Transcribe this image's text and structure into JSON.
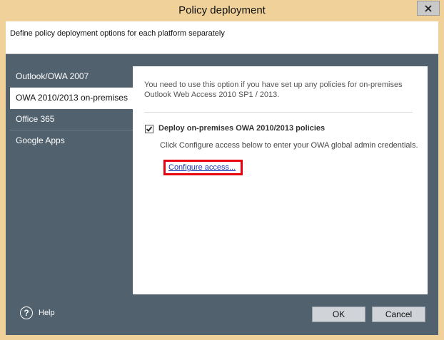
{
  "window": {
    "title": "Policy deployment"
  },
  "header": {
    "description": "Define policy deployment options for each platform separately"
  },
  "sidebar": {
    "items": [
      {
        "label": "Outlook/OWA 2007"
      },
      {
        "label": "OWA 2010/2013 on-premises"
      },
      {
        "label": "Office 365"
      },
      {
        "label": "Google Apps"
      }
    ]
  },
  "panel": {
    "info_line1": "You need to use this option if you have set up any policies for on-premises",
    "info_line2": "Outlook Web Access 2010 SP1 / 2013.",
    "checkbox_label": "Deploy on-premises OWA 2010/2013 policies",
    "checkbox_checked": true,
    "hint": "Click Configure access below to enter your OWA global admin credentials.",
    "configure_link": "Configure access..."
  },
  "footer": {
    "help_label": "Help",
    "ok_label": "OK",
    "cancel_label": "Cancel"
  },
  "colors": {
    "titlebar": "#f0d19a",
    "client_background": "#51616e",
    "highlight_box": "#e8000f",
    "link": "#1b39b5"
  }
}
